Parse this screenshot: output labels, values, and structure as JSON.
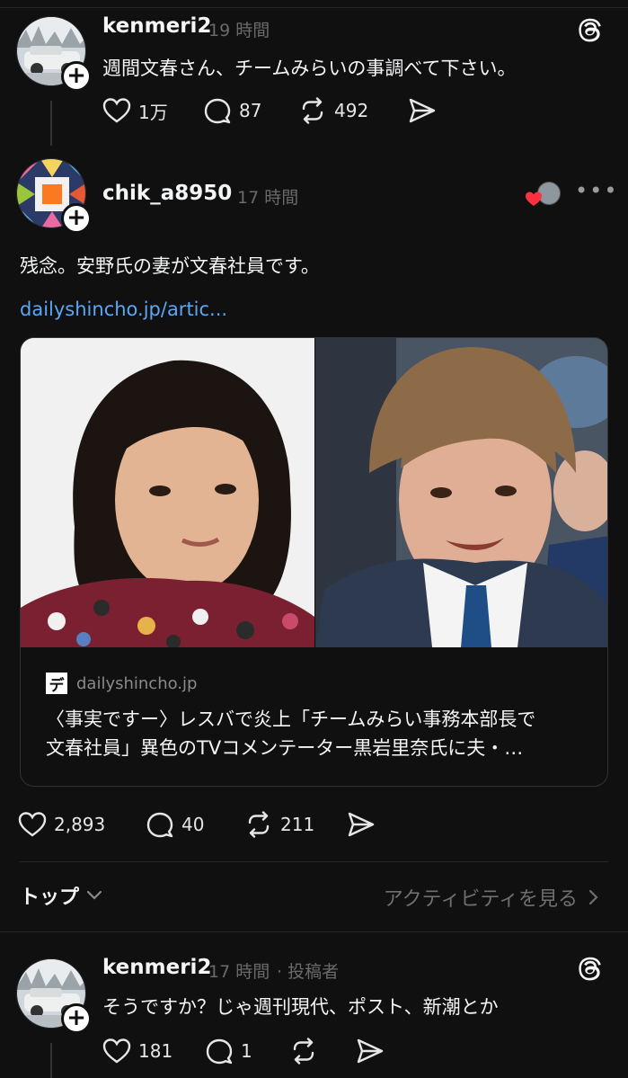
{
  "posts": [
    {
      "username": "kenmeri2",
      "time": "19 時間",
      "text": "週間文春さん、チームみらいの事調べて下さい。",
      "likes": "1万",
      "replies": "87",
      "reposts": "492"
    },
    {
      "username": "chik_a8950",
      "time": "17 時間",
      "text": "残念。安野氏の妻が文春社員です。",
      "link": "dailyshincho.jp/artic...",
      "card": {
        "source": "dailyshincho.jp",
        "source_icon_letter": "デ",
        "title_line1": "〈事実ですー〉レスバで炎上「チームみらい事務本部長で",
        "title_line2": "文春社員」異色のTVコメンテーター黒岩里奈氏に夫・…"
      },
      "likes": "2,893",
      "replies": "40",
      "reposts": "211",
      "more": "•••"
    },
    {
      "username": "kenmeri2",
      "time": "17 時間",
      "author_tag": "· 投稿者",
      "text": "そうですか？じゃ週刊現代、ポスト、新潮とか",
      "likes": "181",
      "replies": "1"
    }
  ],
  "section": {
    "sort_label": "トップ",
    "activity_label": "アクティビティを見る"
  },
  "colors": {
    "background": "#101010",
    "link": "#5ba7f5",
    "muted": "#6a6a6a"
  }
}
